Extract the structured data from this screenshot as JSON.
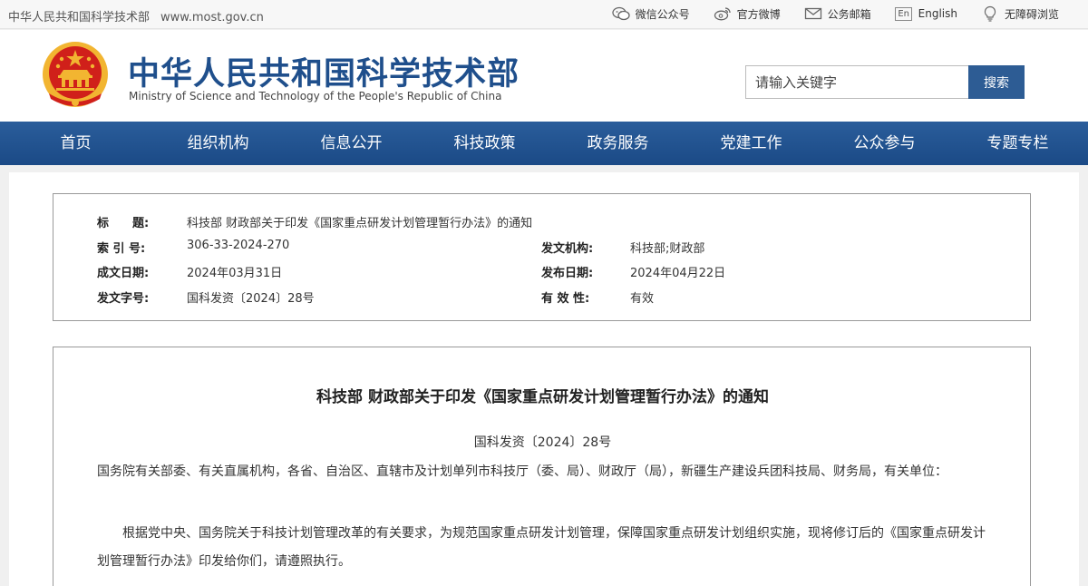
{
  "topbar": {
    "site_name": "中华人民共和国科学技术部",
    "url": "www.most.gov.cn",
    "links": [
      {
        "label": "微信公众号",
        "icon": "wechat-icon"
      },
      {
        "label": "官方微博",
        "icon": "weibo-icon"
      },
      {
        "label": "公务邮箱",
        "icon": "mail-icon"
      },
      {
        "label": "English",
        "icon": "en-icon",
        "icon_text": "En"
      },
      {
        "label": "无障碍浏览",
        "icon": "accessibility-icon"
      }
    ]
  },
  "header": {
    "title_cn": "中华人民共和国科学技术部",
    "title_en": "Ministry of Science and Technology of the People's Republic of China",
    "emblem": "national-emblem-icon"
  },
  "search": {
    "placeholder": "请输入关键字",
    "button": "搜索"
  },
  "nav": [
    "首页",
    "组织机构",
    "信息公开",
    "科技政策",
    "政务服务",
    "党建工作",
    "公众参与",
    "专题专栏"
  ],
  "meta": {
    "title_label": "标　　题:",
    "title_value": "科技部 财政部关于印发《国家重点研发计划管理暂行办法》的通知",
    "index_label": "索 引 号:",
    "index_value": "306-33-2024-270",
    "issuer_label": "发文机构:",
    "issuer_value": "科技部;财政部",
    "created_label": "成文日期:",
    "created_value": "2024年03月31日",
    "published_label": "发布日期:",
    "published_value": "2024年04月22日",
    "doc_no_label": "发文字号:",
    "doc_no_value": "国科发资〔2024〕28号",
    "validity_label": "有 效 性:",
    "validity_value": "有效"
  },
  "document": {
    "title": "科技部 财政部关于印发《国家重点研发计划管理暂行办法》的通知",
    "doc_number": "国科发资〔2024〕28号",
    "addressee": "国务院有关部委、有关直属机构，各省、自治区、直辖市及计划单列市科技厅（委、局）、财政厅（局），新疆生产建设兵团科技局、财务局，有关单位：",
    "body": "根据党中央、国务院关于科技计划管理改革的有关要求，为规范国家重点研发计划管理，保障国家重点研发计划组织实施，现将修订后的《国家重点研发计划管理暂行办法》印发给你们，请遵照执行。"
  },
  "colors": {
    "brand_blue": "#1f4f8c",
    "nav_blue": "#1e4f8d",
    "emblem_red": "#d0201a",
    "emblem_gold": "#f2b531"
  }
}
